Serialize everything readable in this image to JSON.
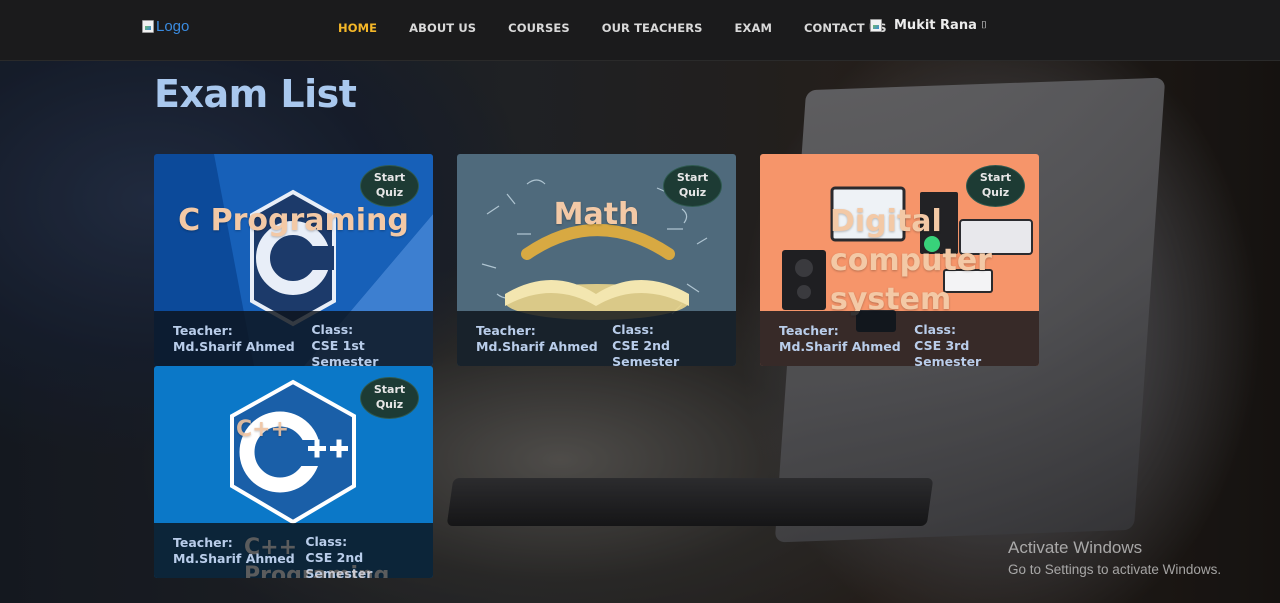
{
  "navbar": {
    "logo_alt": "Logo",
    "links": [
      "HOME",
      "ABOUT US",
      "COURSES",
      "OUR TEACHERS",
      "EXAM",
      "CONTACT US"
    ],
    "user_name": "Mukit Rana",
    "caret": "⌷"
  },
  "page": {
    "title": "Exam List"
  },
  "cards": [
    {
      "title": "C Programing",
      "button": [
        "Start",
        "Quiz"
      ],
      "teacher_label": "Teacher:",
      "teacher": "Md.Sharif Ahmed",
      "class_label": "Class:",
      "class": "CSE 1st Semester"
    },
    {
      "title": "Math",
      "button": [
        "Start",
        "Quiz"
      ],
      "teacher_label": "Teacher:",
      "teacher": "Md.Sharif Ahmed",
      "class_label": "Class:",
      "class": "CSE 2nd Semester"
    },
    {
      "title": "Digital computer system",
      "button": [
        "Start",
        "Quiz"
      ],
      "teacher_label": "Teacher:",
      "teacher": "Md.Sharif Ahmed",
      "class_label": "Class:",
      "class": "CSE 3rd Semester"
    },
    {
      "title": "C++ Programing",
      "button": [
        "Start",
        "Quiz"
      ],
      "teacher_label": "Teacher:",
      "teacher": "Md.Sharif Ahmed",
      "class_label": "Class:",
      "class": "CSE 2nd Semester"
    }
  ],
  "watermark": {
    "title": "Activate Windows",
    "subtitle": "Go to Settings to activate Windows."
  },
  "colors": {
    "accent_active": "#f4b728",
    "title": "#a9c8ee",
    "navbar": "#1b1b1c"
  }
}
